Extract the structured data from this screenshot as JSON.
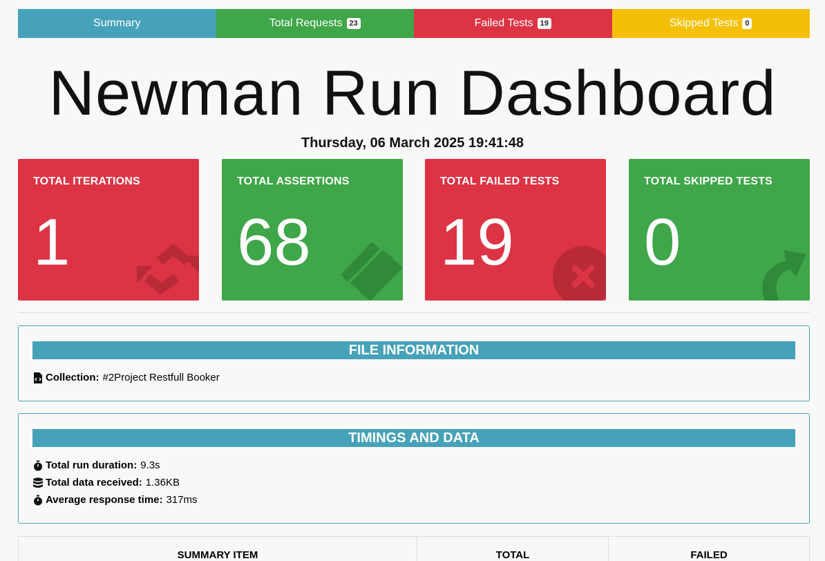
{
  "tabs": [
    {
      "label": "Summary",
      "badge": null
    },
    {
      "label": "Total Requests",
      "badge": "23"
    },
    {
      "label": "Failed Tests",
      "badge": "19"
    },
    {
      "label": "Skipped Tests",
      "badge": "0"
    }
  ],
  "title": "Newman Run Dashboard",
  "datetime": "Thursday, 06 March 2025 19:41:48",
  "cards": [
    {
      "label": "TOTAL ITERATIONS",
      "value": "1",
      "icon": "sync-icon",
      "color": "#dc3444"
    },
    {
      "label": "TOTAL ASSERTIONS",
      "value": "68",
      "icon": "list-icon",
      "color": "#3fa649"
    },
    {
      "label": "TOTAL FAILED TESTS",
      "value": "19",
      "icon": "times-circle-icon",
      "color": "#dc3444"
    },
    {
      "label": "TOTAL SKIPPED TESTS",
      "value": "0",
      "icon": "share-arrow-icon",
      "color": "#3fa649"
    }
  ],
  "file_info": {
    "header": "FILE INFORMATION",
    "collection_label": "Collection:",
    "collection_value": "#2Project Restfull Booker"
  },
  "timings": {
    "header": "TIMINGS AND DATA",
    "duration_label": "Total run duration:",
    "duration_value": "9.3s",
    "data_label": "Total data received:",
    "data_value": "1.36KB",
    "response_label": "Average response time:",
    "response_value": "317ms"
  },
  "table": {
    "headers": [
      "SUMMARY ITEM",
      "TOTAL",
      "FAILED"
    ]
  },
  "colors": {
    "summary": "#46a2b8",
    "success": "#3fa649",
    "danger": "#dc3444",
    "warning": "#f4c007"
  }
}
